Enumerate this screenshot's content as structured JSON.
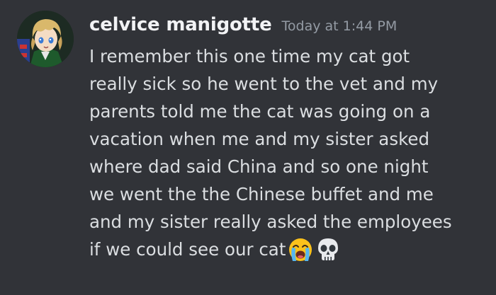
{
  "message": {
    "username": "celvice manigotte",
    "timestamp": "Today at 1:44 PM",
    "lines": [
      "I remember this one time my cat got",
      "really sick so he went to the vet and my",
      "parents told me the cat was going on a",
      "vacation when me and my sister asked",
      "where dad said China and so one night",
      "we went the the Chinese buffet and me",
      "and my sister really asked the employees",
      "if we could see our cat"
    ],
    "emojis": [
      "loudly-crying-face",
      "skull"
    ]
  },
  "colors": {
    "background": "#313338",
    "username": "#f2f3f5",
    "timestamp": "#949ba4",
    "text": "#dbdee1"
  }
}
